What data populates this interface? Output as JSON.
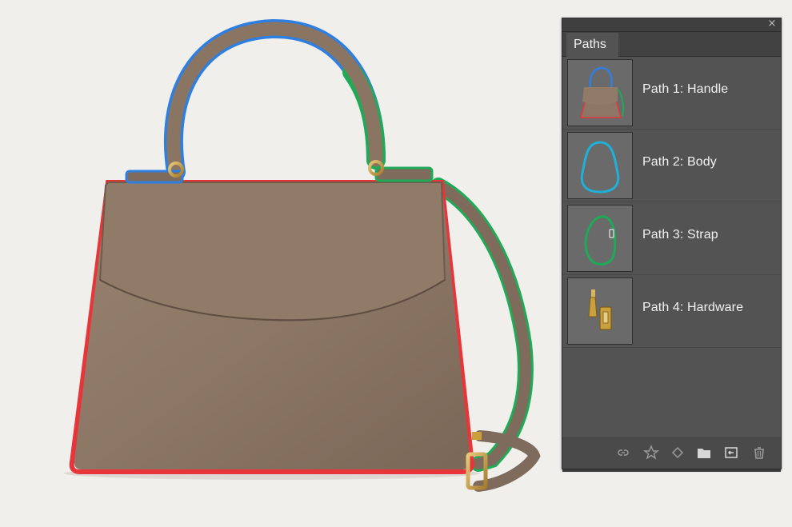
{
  "panel": {
    "tab_label": "Paths",
    "close_glyph": "×",
    "paths": [
      {
        "label": "Path 1: Handle",
        "color": "#2e7fe0"
      },
      {
        "label": "Path 2: Body",
        "color": "#1fb0d8"
      },
      {
        "label": "Path 3: Strap",
        "color": "#1faa58"
      },
      {
        "label": "Path 4: Hardware",
        "color": "#c9a03c"
      }
    ],
    "footer_icons": [
      "load-as-selection-icon",
      "work-path-icon",
      "stroke-path-icon",
      "new-group-folder-icon",
      "add-mask-icon",
      "trash-icon"
    ]
  },
  "outline_colors": {
    "handle": "#2e7fe0",
    "strap": "#1faa58",
    "body": "#e8353a",
    "leather": "#8c7766",
    "hardware": "#c9a03c"
  }
}
